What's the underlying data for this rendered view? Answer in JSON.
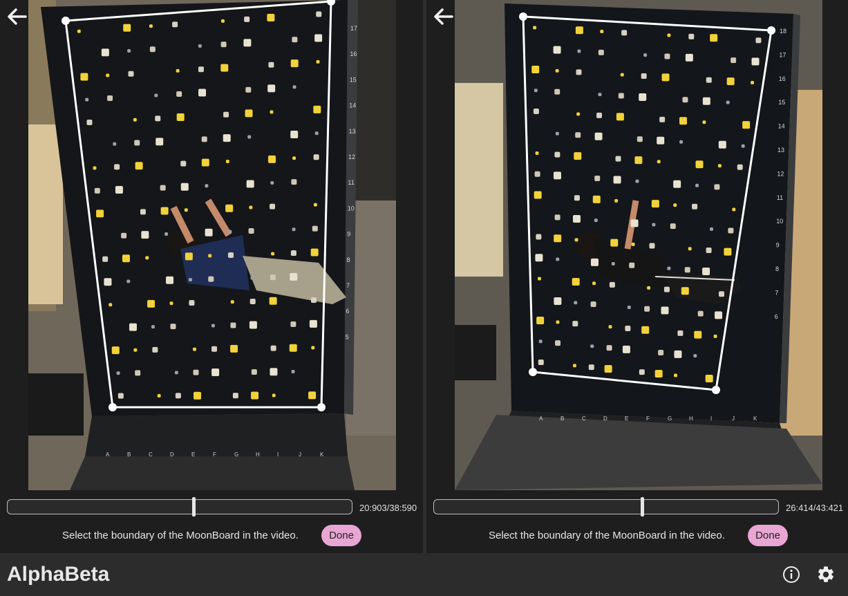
{
  "app": {
    "title": "AlphaBeta"
  },
  "panels": [
    {
      "frame_label": "20:903/38:590",
      "instruction": "Select the boundary of the MoonBoard in the video.",
      "done_label": "Done",
      "progress": 0.54,
      "row_numbers": [
        "17",
        "16",
        "15",
        "14",
        "13",
        "12",
        "11",
        "10",
        "9",
        "8",
        "7",
        "6",
        "5"
      ],
      "col_letters": [
        "A",
        "B",
        "C",
        "D",
        "E",
        "F",
        "G",
        "H",
        "I",
        "J",
        "K"
      ]
    },
    {
      "frame_label": "26:414/43:421",
      "instruction": "Select the boundary of the MoonBoard in the video.",
      "done_label": "Done",
      "progress": 0.605,
      "row_numbers": [
        "18",
        "17",
        "16",
        "15",
        "14",
        "13",
        "12",
        "11",
        "10",
        "9",
        "8",
        "7",
        "6"
      ],
      "col_letters": [
        "A",
        "B",
        "C",
        "D",
        "E",
        "F",
        "G",
        "H",
        "I",
        "J",
        "K"
      ]
    }
  ],
  "icons": {
    "back": "arrow-left-icon",
    "info": "info-icon",
    "settings": "gear-icon"
  }
}
